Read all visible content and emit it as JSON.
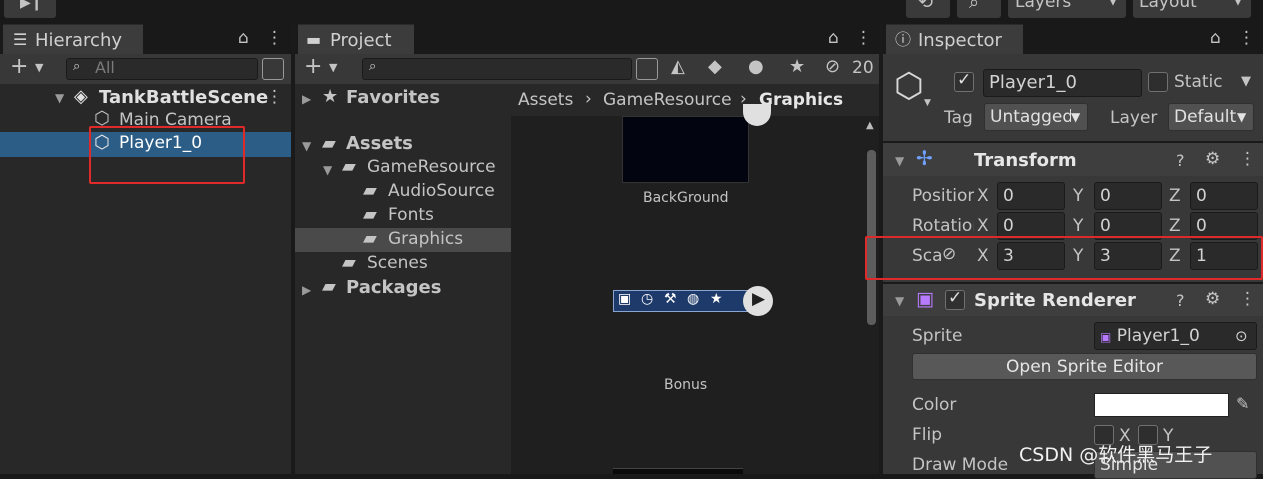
{
  "window": {
    "layers_label": "Layers",
    "layout_label": "Layout"
  },
  "hierarchy": {
    "tab": "Hierarchy",
    "search_placeholder": "All",
    "scene": "TankBattleScene",
    "items": [
      "Main Camera",
      "Player1_0"
    ]
  },
  "project": {
    "tab": "Project",
    "hidden_count": "20",
    "tree": {
      "favorites": "Favorites",
      "assets": "Assets",
      "game_resource": "GameResource",
      "audio_source": "AudioSource",
      "fonts": "Fonts",
      "graphics": "Graphics",
      "scenes": "Scenes",
      "packages": "Packages"
    },
    "breadcrumb": [
      "Assets",
      "GameResource",
      "Graphics"
    ],
    "assets_grid": [
      "BackGround",
      "Bonus"
    ]
  },
  "inspector": {
    "tab": "Inspector",
    "object_name": "Player1_0",
    "static_label": "Static",
    "tag_label": "Tag",
    "tag_value": "Untagged",
    "layer_label": "Layer",
    "layer_value": "Default",
    "transform": {
      "title": "Transform",
      "position_label": "Position",
      "rotation_label": "Rotation",
      "scale_label": "Scale",
      "position": {
        "x": "0",
        "y": "0",
        "z": "0"
      },
      "rotation": {
        "x": "0",
        "y": "0",
        "z": "0"
      },
      "scale": {
        "x": "3",
        "y": "3",
        "z": "1"
      },
      "axis_x": "X",
      "axis_y": "Y",
      "axis_z": "Z"
    },
    "sprite_renderer": {
      "title": "Sprite Renderer",
      "sprite_label": "Sprite",
      "sprite_value": "Player1_0",
      "open_editor": "Open Sprite Editor",
      "color_label": "Color",
      "color_value": "#ffffff",
      "flip_label": "Flip",
      "flip_x": "X",
      "flip_y": "Y",
      "draw_mode_label": "Draw Mode",
      "draw_mode_value": "Simple"
    }
  },
  "watermark": "CSDN @软件黑马王子"
}
